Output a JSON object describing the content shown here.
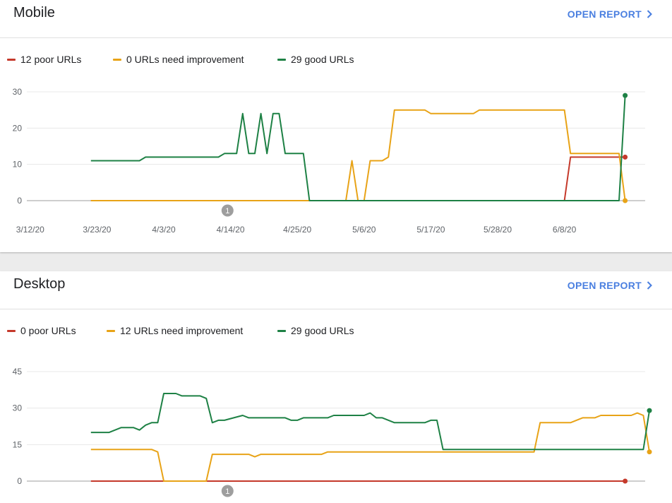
{
  "colors": {
    "poor": "#c5392b",
    "needs_improvement": "#e8a317",
    "good": "#1e8145",
    "link": "#4a7fe0",
    "annotation": "#9e9e9e"
  },
  "mobile": {
    "title": "Mobile",
    "open_report_label": "OPEN REPORT",
    "legend": {
      "poor": "12 poor URLs",
      "needs_improvement": "0 URLs need improvement",
      "good": "29 good URLs"
    },
    "chart_data": {
      "type": "line",
      "x_labels": [
        "3/12/20",
        "3/23/20",
        "4/3/20",
        "4/14/20",
        "4/25/20",
        "5/6/20",
        "5/17/20",
        "5/28/20",
        "6/8/20"
      ],
      "y_ticks": [
        "30",
        "20",
        "10",
        "0"
      ],
      "ylim": [
        0,
        30
      ],
      "annotation": {
        "label": "1",
        "day": 10.5
      },
      "series": [
        {
          "name": "poor",
          "points": [
            [
              -12,
              0
            ],
            [
              0,
              0
            ],
            [
              66,
              0
            ],
            [
              67,
              12
            ],
            [
              76,
              12
            ]
          ]
        },
        {
          "name": "needs_improvement",
          "points": [
            [
              -12,
              0
            ],
            [
              0,
              0
            ],
            [
              30,
              0
            ],
            [
              31,
              11
            ],
            [
              32,
              0
            ],
            [
              33,
              0
            ],
            [
              34,
              11
            ],
            [
              36,
              11
            ],
            [
              37,
              12
            ],
            [
              38,
              25
            ],
            [
              43,
              25
            ],
            [
              44,
              24
            ],
            [
              51,
              24
            ],
            [
              52,
              25
            ],
            [
              66,
              25
            ],
            [
              67,
              13
            ],
            [
              75,
              13
            ],
            [
              76,
              0
            ]
          ]
        },
        {
          "name": "good",
          "points": [
            [
              -12,
              11
            ],
            [
              -4,
              11
            ],
            [
              -3,
              12
            ],
            [
              9,
              12
            ],
            [
              10,
              13
            ],
            [
              12,
              13
            ],
            [
              13,
              24
            ],
            [
              14,
              13
            ],
            [
              15,
              13
            ],
            [
              16,
              24
            ],
            [
              17,
              13
            ],
            [
              18,
              24
            ],
            [
              19,
              24
            ],
            [
              20,
              13
            ],
            [
              23,
              13
            ],
            [
              24,
              0
            ],
            [
              75,
              0
            ],
            [
              76,
              29
            ]
          ]
        }
      ]
    }
  },
  "desktop": {
    "title": "Desktop",
    "open_report_label": "OPEN REPORT",
    "legend": {
      "poor": "0 poor URLs",
      "needs_improvement": "12 URLs need improvement",
      "good": "29 good URLs"
    },
    "chart_data": {
      "type": "line",
      "x_labels": [],
      "y_ticks": [
        "45",
        "30",
        "15",
        "0"
      ],
      "ylim": [
        0,
        45
      ],
      "annotation": {
        "label": "1",
        "day": 10.5
      },
      "series": [
        {
          "name": "poor",
          "points": [
            [
              -12,
              0
            ],
            [
              76,
              0
            ]
          ]
        },
        {
          "name": "needs_improvement",
          "points": [
            [
              -12,
              13
            ],
            [
              -2,
              13
            ],
            [
              -1,
              12
            ],
            [
              0,
              0
            ],
            [
              7,
              0
            ],
            [
              8,
              11
            ],
            [
              14,
              11
            ],
            [
              15,
              10
            ],
            [
              16,
              11
            ],
            [
              26,
              11
            ],
            [
              27,
              12
            ],
            [
              61,
              12
            ],
            [
              62,
              24
            ],
            [
              67,
              24
            ],
            [
              69,
              26
            ],
            [
              71,
              26
            ],
            [
              72,
              27
            ],
            [
              77,
              27
            ],
            [
              78,
              28
            ],
            [
              79,
              27
            ],
            [
              80,
              12
            ]
          ]
        },
        {
          "name": "good",
          "points": [
            [
              -12,
              20
            ],
            [
              -9,
              20
            ],
            [
              -7,
              22
            ],
            [
              -5,
              22
            ],
            [
              -4,
              21
            ],
            [
              -3,
              23
            ],
            [
              -2,
              24
            ],
            [
              -1,
              24
            ],
            [
              0,
              36
            ],
            [
              2,
              36
            ],
            [
              3,
              35
            ],
            [
              6,
              35
            ],
            [
              7,
              34
            ],
            [
              8,
              24
            ],
            [
              9,
              25
            ],
            [
              10,
              25
            ],
            [
              13,
              27
            ],
            [
              14,
              26
            ],
            [
              20,
              26
            ],
            [
              21,
              25
            ],
            [
              22,
              25
            ],
            [
              23,
              26
            ],
            [
              27,
              26
            ],
            [
              28,
              27
            ],
            [
              33,
              27
            ],
            [
              34,
              28
            ],
            [
              35,
              26
            ],
            [
              36,
              26
            ],
            [
              38,
              24
            ],
            [
              43,
              24
            ],
            [
              44,
              25
            ],
            [
              45,
              25
            ],
            [
              46,
              13
            ],
            [
              79,
              13
            ],
            [
              80,
              29
            ]
          ]
        }
      ]
    }
  }
}
